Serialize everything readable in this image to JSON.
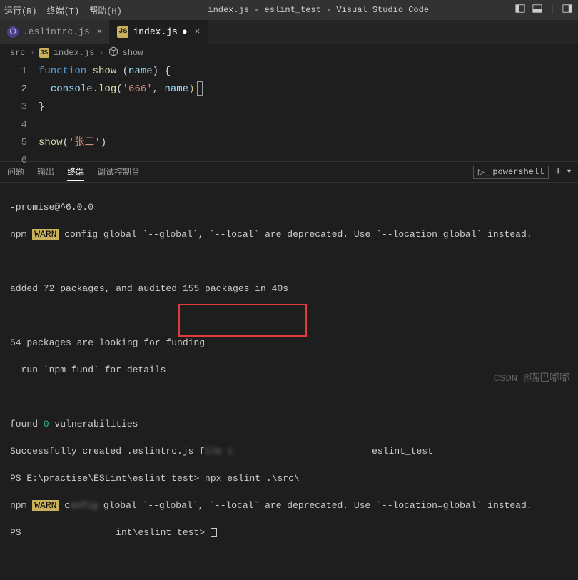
{
  "menu": {
    "run": "运行(R)",
    "terminal": "终端(T)",
    "help": "帮助(H)"
  },
  "window_title": "index.js - eslint_test - Visual Studio Code",
  "tabs": [
    {
      "icon": "eslint",
      "label": ".eslintrc.js"
    },
    {
      "icon": "js",
      "label": "index.js"
    }
  ],
  "breadcrumb": {
    "p1": "src",
    "p2": "index.js",
    "p3": "show"
  },
  "gutter": [
    "1",
    "2",
    "3",
    "4",
    "5",
    "6"
  ],
  "code": {
    "kw_function": "function",
    "fn_show": "show",
    "var_name": "name",
    "obj_console": "console",
    "fn_log": "log",
    "str_666": "'666'",
    "brace_o": "(",
    "brace_c": ")",
    "curly_o": "{",
    "curly_c": "}",
    "comma": ", ",
    "call_show": "show",
    "str_zs": "'张三'"
  },
  "panel": {
    "t1": "问题",
    "t2": "输出",
    "t3": "终端",
    "t4": "调试控制台",
    "shell": "powershell"
  },
  "term": {
    "l1": "-promise@^6.0.0",
    "warn": "WARN",
    "l2_pre": "npm ",
    "l2_post": " config global `--global`, `--local` are deprecated. Use `--location=global` instead.",
    "l3": "added 72 packages, and audited 155 packages in 40s",
    "l4": "54 packages are looking for funding",
    "l5": "  run `npm fund` for details",
    "l6_pre": "found ",
    "l6_num": "0",
    "l6_post": " vulnerabilities",
    "l7_pre": "Successfully created .eslintrc.js f",
    "l7_blur": "ile i",
    "l7_post": "eslint_test",
    "l8_prompt": "PS E:\\practise\\ESLint\\eslint_test> ",
    "l8_cmd": "npx eslint .\\src\\",
    "l9_pre": "npm ",
    "l9_mid": " config global `--global`, `--local` are deprecated. Use `--location=global` instead.",
    "l9_blur": "onfig",
    "l10_pre": "PS",
    "l10_blur": "",
    "l10_mid": "int\\eslint_test> "
  },
  "watermark": "CSDN @嘴巴嘟嘟"
}
